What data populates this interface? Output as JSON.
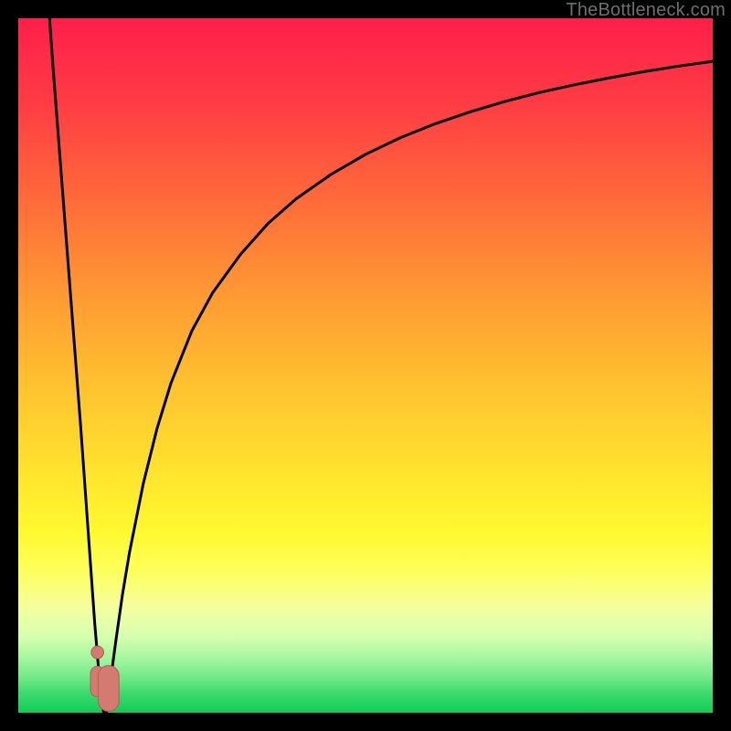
{
  "watermark": "TheBottleneck.com",
  "colors": {
    "frame": "#000000",
    "curve": "#000000",
    "marker_fill": "#d57a70",
    "marker_stroke": "#b85b52"
  },
  "chart_data": {
    "type": "line",
    "title": "",
    "xlabel": "",
    "ylabel": "",
    "xlim": [
      0,
      100
    ],
    "ylim": [
      0,
      100
    ],
    "grid": false,
    "series": [
      {
        "name": "left-branch",
        "x": [
          4.5,
          5,
          6,
          7,
          8,
          9,
          10,
          10.5,
          11,
          11.5,
          12,
          12.3
        ],
        "y": [
          100,
          93,
          80,
          67,
          54,
          41,
          27,
          20,
          13,
          7,
          2,
          0
        ]
      },
      {
        "name": "right-branch",
        "x": [
          12.7,
          13.2,
          14,
          15,
          16,
          18,
          20,
          22,
          25,
          28,
          32,
          36,
          40,
          45,
          50,
          55,
          60,
          65,
          70,
          75,
          80,
          85,
          90,
          95,
          100
        ],
        "y": [
          0,
          4,
          10,
          17,
          23,
          33,
          41,
          47.5,
          55,
          60.5,
          66,
          70.5,
          74,
          77.5,
          80.4,
          82.8,
          84.8,
          86.5,
          88,
          89.3,
          90.4,
          91.4,
          92.3,
          93.1,
          93.8
        ]
      }
    ],
    "markers": [
      {
        "name": "marker-left",
        "x": 11.4,
        "y": 4.5,
        "r": 1.0
      },
      {
        "name": "marker-right",
        "x": 13.0,
        "y": 3.5,
        "r": 1.5
      }
    ],
    "annotations": []
  }
}
